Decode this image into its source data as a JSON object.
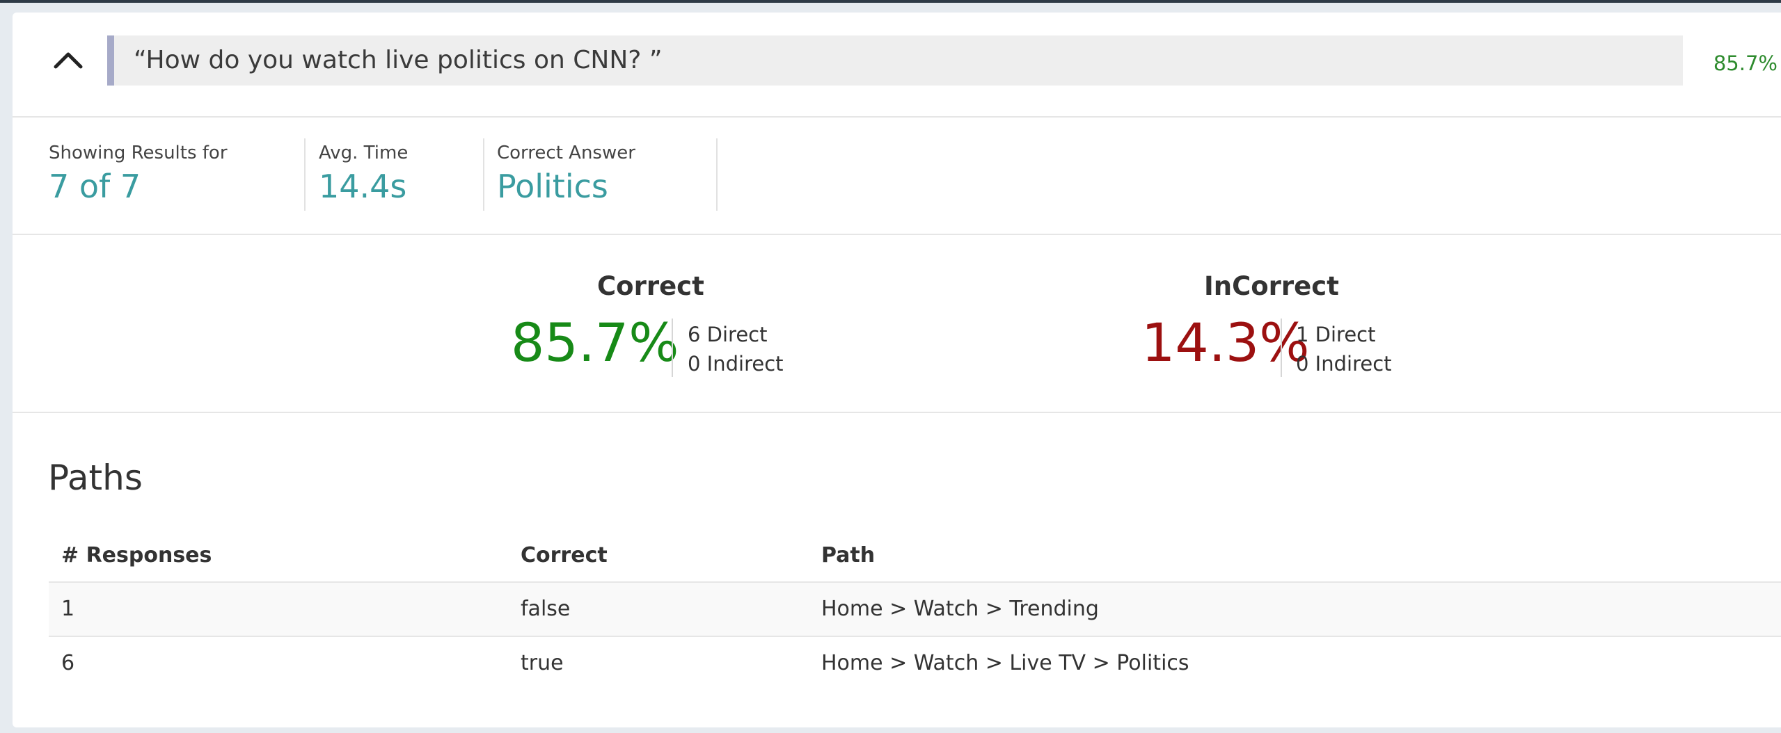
{
  "question": {
    "text": "“How do you watch live politics on CNN? ”",
    "percent": "85.7%"
  },
  "stats": {
    "showing": {
      "label": "Showing Results for",
      "value": "7 of 7"
    },
    "avg_time": {
      "label": "Avg. Time",
      "value": "14.4s"
    },
    "correct_answer": {
      "label": "Correct Answer",
      "value": "Politics"
    }
  },
  "summary": {
    "correct": {
      "title": "Correct",
      "percent": "85.7%",
      "direct": "6 Direct",
      "indirect": "0 Indirect",
      "color": "#178a17"
    },
    "incorrect": {
      "title": "InCorrect",
      "percent": "14.3%",
      "direct": "1 Direct",
      "indirect": "0 Indirect",
      "color": "#9c1010"
    }
  },
  "paths": {
    "title": "Paths",
    "columns": [
      "# Responses",
      "Correct",
      "Path"
    ],
    "rows": [
      {
        "responses": "1",
        "correct": "false",
        "path": "Home > Watch > Trending"
      },
      {
        "responses": "6",
        "correct": "true",
        "path": "Home > Watch > Live TV > Politics"
      }
    ]
  },
  "icons": {
    "collapse": "chevron-up-icon"
  }
}
